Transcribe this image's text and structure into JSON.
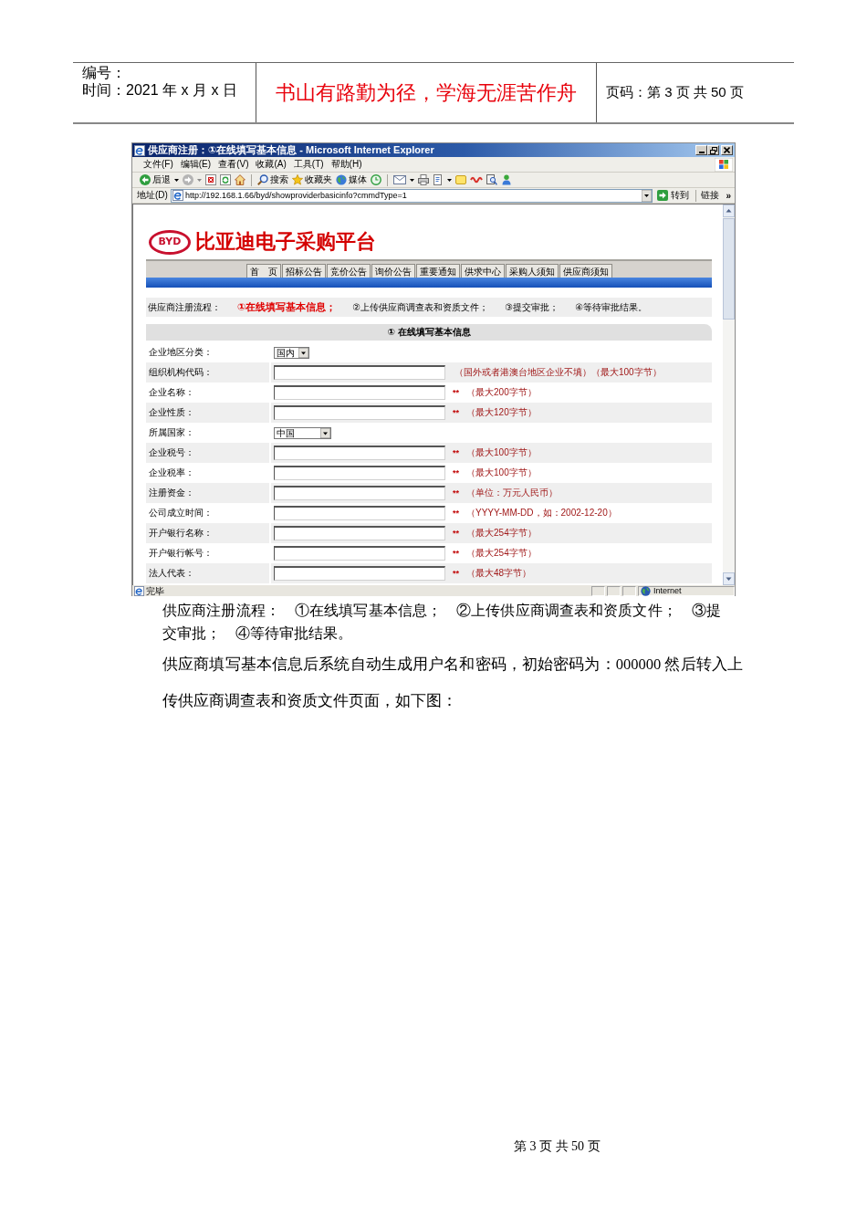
{
  "document_header": {
    "number_label": "编号：",
    "date_line": "时间：2021 年 x 月 x 日",
    "motto": "书山有路勤为径，学海无涯苦作舟",
    "page_info": "页码：第 3 页 共 50 页"
  },
  "browser": {
    "title": "供应商注册：①在线填写基本信息 - Microsoft Internet Explorer",
    "menu": [
      "文件(F)",
      "编辑(E)",
      "查看(V)",
      "收藏(A)",
      "工具(T)",
      "帮助(H)"
    ],
    "toolbar_labels": [
      "后退",
      "搜索",
      "收藏夹",
      "媒体"
    ],
    "address_label": "地址(D)",
    "url": "http://192.168.1.66/byd/showproviderbasicinfo?cmmdType=1",
    "go_label": "转到",
    "links_label": "链接",
    "more_label": "»",
    "status_text": "完毕",
    "zone_label": "Internet"
  },
  "site": {
    "logo_text": "BYD",
    "title": "比亚迪电子采购平台",
    "nav": [
      "首　页",
      "招标公告",
      "竞价公告",
      "询价公告",
      "重要通知",
      "供求中心",
      "采购人须知",
      "供应商须知"
    ],
    "flow_label": "供应商注册流程：",
    "steps": [
      {
        "text": "①在线填写基本信息；",
        "active": true
      },
      {
        "text": "②上传供应商调查表和资质文件；",
        "active": false
      },
      {
        "text": "③提交审批；",
        "active": false
      },
      {
        "text": "④等待审批结果。",
        "active": false
      }
    ],
    "section_title": "① 在线填写基本信息",
    "fields": [
      {
        "label": "企业地区分类：",
        "kind": "select",
        "value": "国内"
      },
      {
        "label": "组织机构代码：",
        "kind": "text",
        "hint": "（国外或者港澳台地区企业不填）（最大100字节）"
      },
      {
        "label": "企业名称：",
        "kind": "text",
        "mark": "**",
        "hint": "（最大200字节）"
      },
      {
        "label": "企业性质：",
        "kind": "text",
        "mark": "**",
        "hint": "（最大120字节）"
      },
      {
        "label": "所属国家：",
        "kind": "select",
        "value": "中国"
      },
      {
        "label": "企业税号：",
        "kind": "text",
        "mark": "**",
        "hint": "（最大100字节）"
      },
      {
        "label": "企业税率：",
        "kind": "text",
        "mark": "**",
        "hint": "（最大100字节）"
      },
      {
        "label": "注册资金：",
        "kind": "text",
        "mark": "**",
        "hint": "（单位：万元人民币）"
      },
      {
        "label": "公司成立时间：",
        "kind": "text",
        "mark": "**",
        "hint": "（YYYY-MM-DD，如：2002-12-20）"
      },
      {
        "label": "开户银行名称：",
        "kind": "text",
        "mark": "**",
        "hint": "（最大254字节）"
      },
      {
        "label": "开户银行帐号：",
        "kind": "text",
        "mark": "**",
        "hint": "（最大254字节）"
      },
      {
        "label": "法人代表：",
        "kind": "text",
        "mark": "**",
        "hint": "（最大48字节）"
      }
    ]
  },
  "paragraphs": [
    "供应商注册流程：　①在线填写基本信息；　②上传供应商调查表和资质文件；　③提交审批；　④等待审批结果。",
    "供应商填写基本信息后系统自动生成用户名和密码，初始密码为：000000 然后转入上传供应商调查表和资质文件页面，如下图："
  ],
  "footer": "第 3 页 共 50 页"
}
